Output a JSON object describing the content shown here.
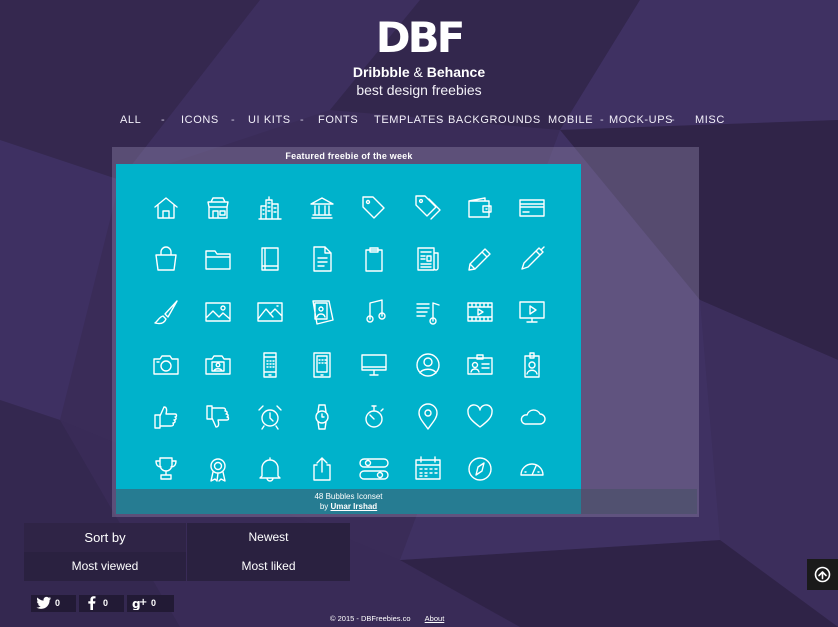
{
  "header": {
    "logo": "DBF",
    "tagline_brand1": "Dribbble",
    "tagline_amp": "&",
    "tagline_brand2": "Behance",
    "tagline_sub": "best design freebies"
  },
  "nav": {
    "items": [
      "ALL",
      "ICONS",
      "UI KITS",
      "FONTS",
      "TEMPLATES",
      "BACKGROUNDS",
      "MOBILE",
      "MOCK-UPS",
      "MISC"
    ],
    "separator": "-"
  },
  "featured": {
    "title": "Featured freebie of the week",
    "caption_title": "48 Bubbles Iconset",
    "caption_by": "by",
    "author": "Umar Irshad",
    "bg_color": "#00b2cb",
    "icons": [
      [
        "home-icon",
        "shop-icon",
        "city-icon",
        "bank-icon",
        "tag-icon",
        "tags-icon",
        "wallet-icon",
        "credit-card-icon"
      ],
      [
        "shopping-bag-icon",
        "folder-icon",
        "book-icon",
        "document-icon",
        "clipboard-icon",
        "newspaper-icon",
        "pencil-icon",
        "pen-icon"
      ],
      [
        "brush-icon",
        "image-icon",
        "landscape-icon",
        "photos-icon",
        "music-note-icon",
        "playlist-icon",
        "film-icon",
        "monitor-play-icon"
      ],
      [
        "camera-icon",
        "camera-alt-icon",
        "phone-icon",
        "tablet-icon",
        "desktop-icon",
        "user-circle-icon",
        "id-card-icon",
        "badge-icon"
      ],
      [
        "thumbs-up-icon",
        "thumbs-down-icon",
        "alarm-clock-icon",
        "watch-icon",
        "stopwatch-icon",
        "map-pin-icon",
        "heart-icon",
        "cloud-icon"
      ],
      [
        "trophy-icon",
        "award-icon",
        "bell-icon",
        "share-icon",
        "toggles-icon",
        "calendar-icon",
        "compass-icon",
        "gauge-icon"
      ]
    ]
  },
  "sort": {
    "label": "Sort by",
    "newest": "Newest",
    "most_viewed": "Most viewed",
    "most_liked": "Most liked"
  },
  "social": [
    {
      "name": "twitter-icon",
      "count": "0"
    },
    {
      "name": "facebook-icon",
      "count": "0"
    },
    {
      "name": "google-plus-icon",
      "count": "0"
    }
  ],
  "footer": {
    "copyright": "© 2015 - DBFreebies.co",
    "about": "About"
  },
  "back_to_top": {
    "icon": "arrow-up-circle-icon"
  },
  "colors": {
    "background": "#3b2d5a",
    "featured_bg": "#00b2cb",
    "sort_cell": "#2a2140"
  }
}
